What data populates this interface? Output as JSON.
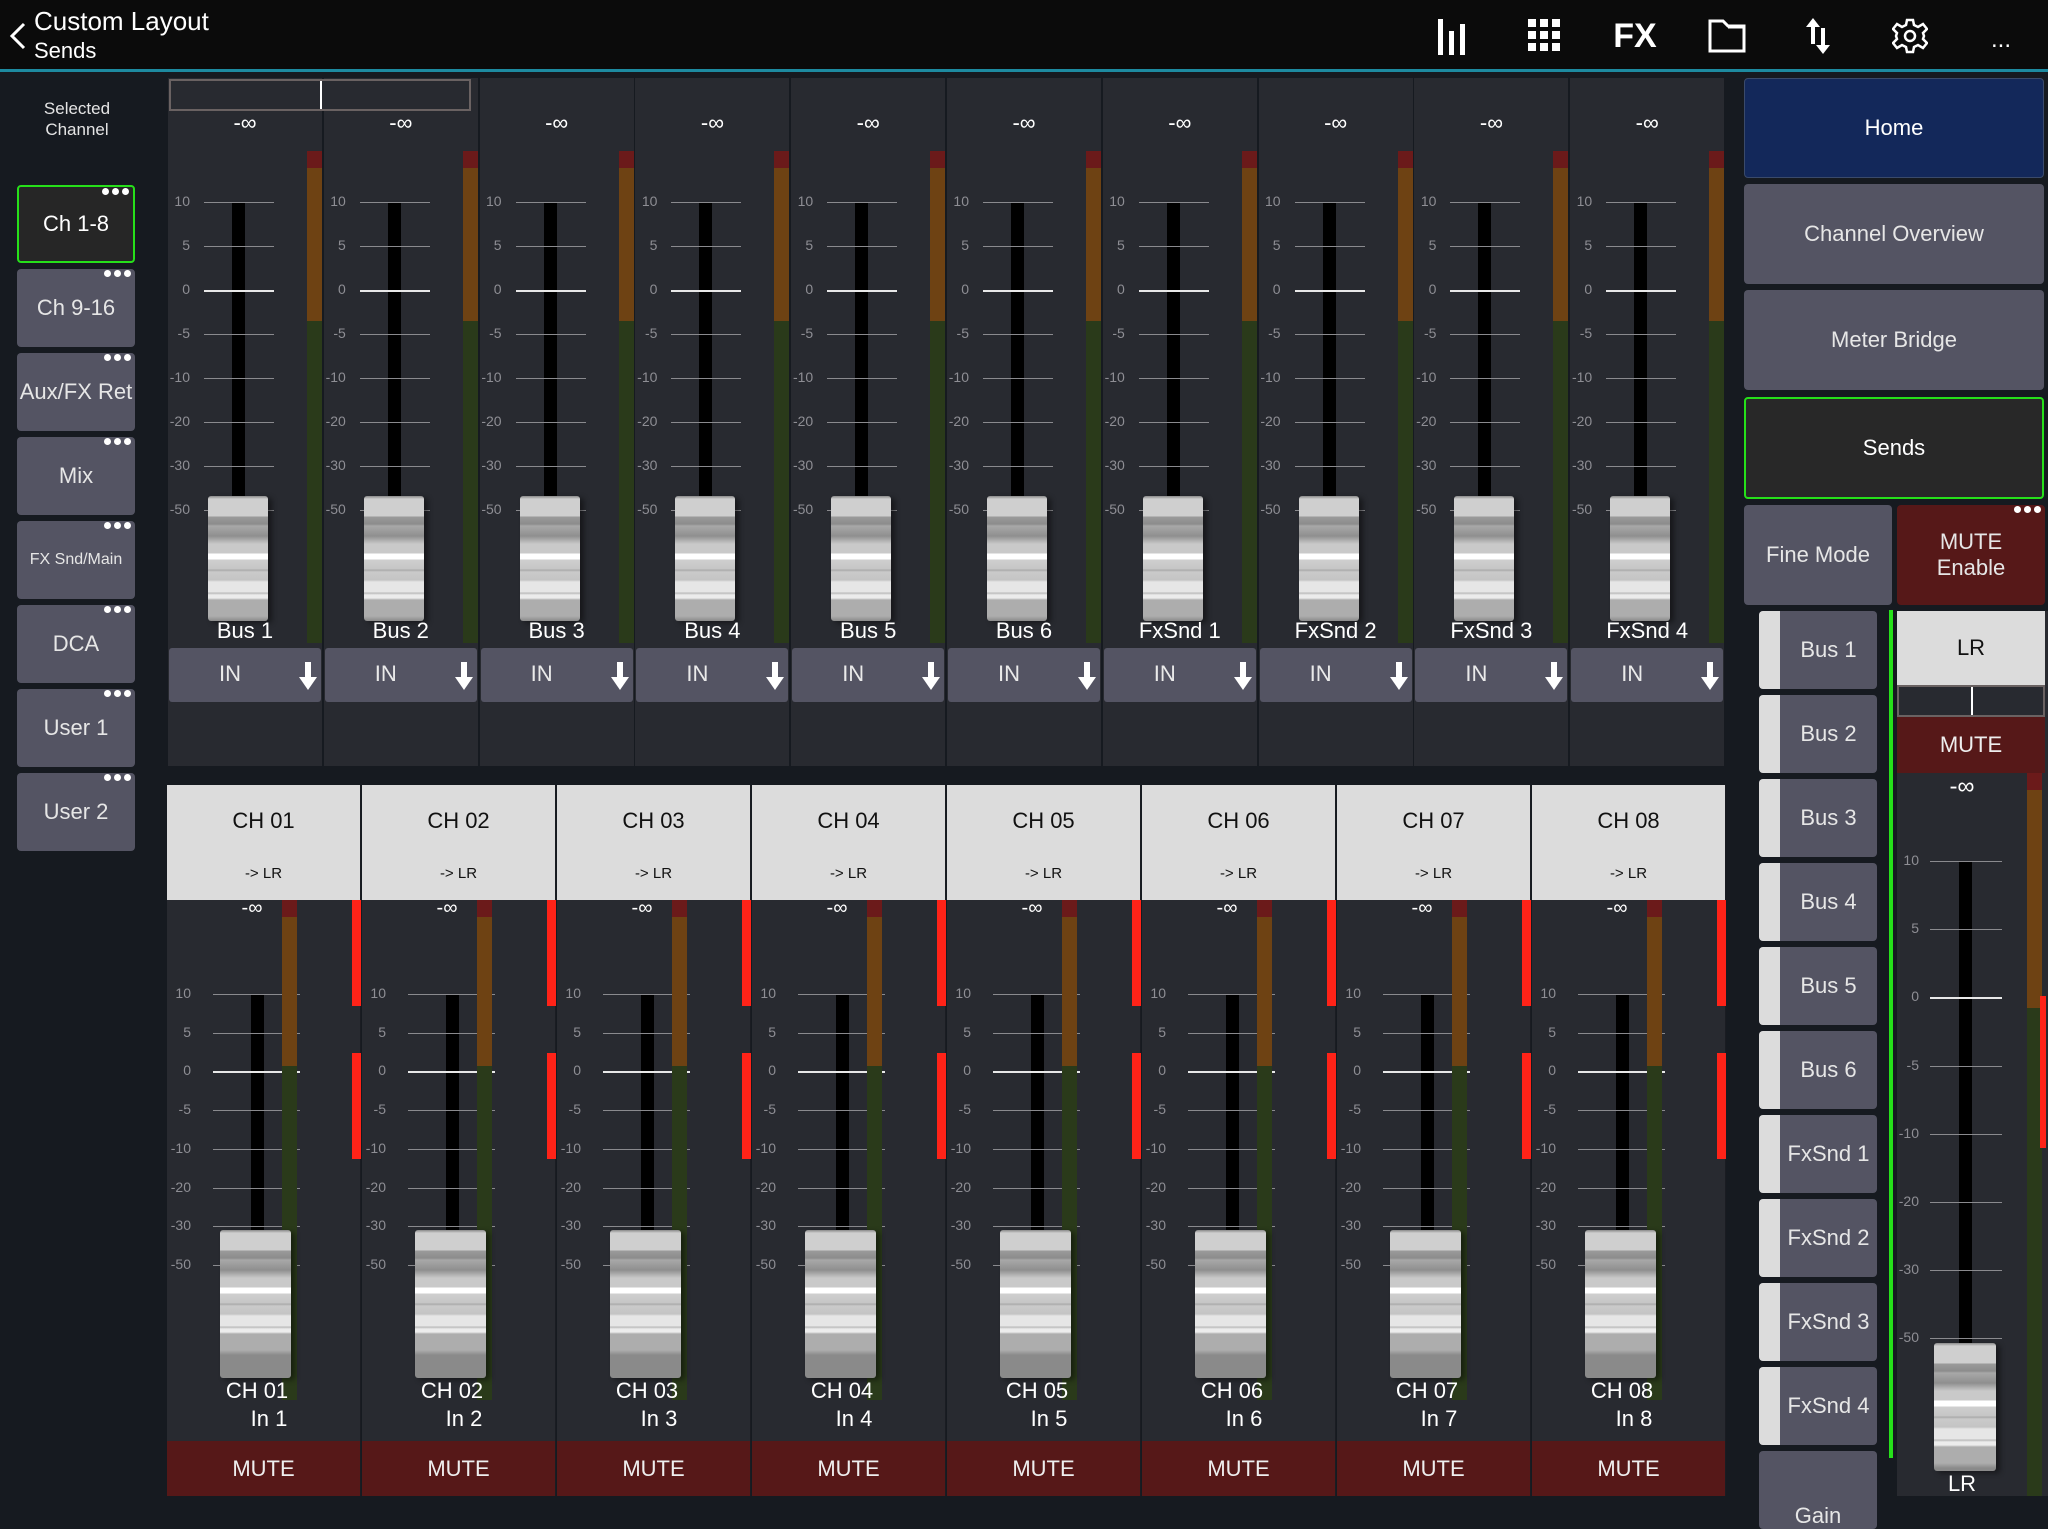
{
  "header": {
    "title": "Custom Layout",
    "subtitle": "Sends",
    "toolbar": [
      {
        "name": "meters-icon"
      },
      {
        "name": "grid-icon"
      },
      {
        "name": "fx-icon",
        "label": "FX"
      },
      {
        "name": "folder-icon"
      },
      {
        "name": "transfer-icon"
      },
      {
        "name": "gear-icon"
      },
      {
        "name": "more-icon",
        "label": "..."
      }
    ]
  },
  "sidebar": {
    "label": "Selected Channel",
    "items": [
      {
        "label": "Ch 1-8",
        "active": true
      },
      {
        "label": "Ch 9-16"
      },
      {
        "label": "Aux/FX Ret"
      },
      {
        "label": "Mix"
      },
      {
        "label": "FX Snd/Main",
        "small": true
      },
      {
        "label": "DCA"
      },
      {
        "label": "User 1"
      },
      {
        "label": "User 2"
      }
    ]
  },
  "scale": [
    "10",
    "5",
    "0",
    "-5",
    "-10",
    "-20",
    "-30",
    "-50"
  ],
  "bus_strips": [
    {
      "name": "Bus 1",
      "value": "-∞",
      "route": "IN"
    },
    {
      "name": "Bus 2",
      "value": "-∞",
      "route": "IN"
    },
    {
      "name": "Bus 3",
      "value": "-∞",
      "route": "IN"
    },
    {
      "name": "Bus 4",
      "value": "-∞",
      "route": "IN"
    },
    {
      "name": "Bus 5",
      "value": "-∞",
      "route": "IN"
    },
    {
      "name": "Bus 6",
      "value": "-∞",
      "route": "IN"
    },
    {
      "name": "FxSnd 1",
      "value": "-∞",
      "route": "IN"
    },
    {
      "name": "FxSnd 2",
      "value": "-∞",
      "route": "IN"
    },
    {
      "name": "FxSnd 3",
      "value": "-∞",
      "route": "IN"
    },
    {
      "name": "FxSnd 4",
      "value": "-∞",
      "route": "IN"
    }
  ],
  "channels": [
    {
      "header": "CH 01",
      "route": "-> LR",
      "value": "-∞",
      "name": "CH 01",
      "source": "In 1",
      "mute": "MUTE"
    },
    {
      "header": "CH 02",
      "route": "-> LR",
      "value": "-∞",
      "name": "CH 02",
      "source": "In 2",
      "mute": "MUTE"
    },
    {
      "header": "CH 03",
      "route": "-> LR",
      "value": "-∞",
      "name": "CH 03",
      "source": "In 3",
      "mute": "MUTE"
    },
    {
      "header": "CH 04",
      "route": "-> LR",
      "value": "-∞",
      "name": "CH 04",
      "source": "In 4",
      "mute": "MUTE"
    },
    {
      "header": "CH 05",
      "route": "-> LR",
      "value": "-∞",
      "name": "CH 05",
      "source": "In 5",
      "mute": "MUTE"
    },
    {
      "header": "CH 06",
      "route": "-> LR",
      "value": "-∞",
      "name": "CH 06",
      "source": "In 6",
      "mute": "MUTE"
    },
    {
      "header": "CH 07",
      "route": "-> LR",
      "value": "-∞",
      "name": "CH 07",
      "source": "In 7",
      "mute": "MUTE"
    },
    {
      "header": "CH 08",
      "route": "-> LR",
      "value": "-∞",
      "name": "CH 08",
      "source": "In 8",
      "mute": "MUTE"
    }
  ],
  "right_panel": {
    "nav": [
      {
        "label": "Home",
        "kind": "home"
      },
      {
        "label": "Channel Overview"
      },
      {
        "label": "Meter Bridge"
      },
      {
        "label": "Sends",
        "kind": "sends"
      }
    ],
    "fine_mode": "Fine Mode",
    "mute_enable": "MUTE\nEnable",
    "bus_list": [
      "Bus 1",
      "Bus 2",
      "Bus 3",
      "Bus 4",
      "Bus 5",
      "Bus 6",
      "FxSnd 1",
      "FxSnd 2",
      "FxSnd 3",
      "FxSnd 4",
      "Gain"
    ],
    "main": {
      "header": "LR",
      "mute": "MUTE",
      "value": "-∞",
      "name": "LR"
    },
    "main_scale": [
      "10",
      "5",
      "0",
      "-5",
      "-10",
      "-20",
      "-30",
      "-50"
    ]
  },
  "colors": {
    "accent_green": "#26e01a",
    "teal_line": "#1d8aa0",
    "mute_red": "#561818",
    "home_blue": "#13285a",
    "meter_green": "#2a3a1a",
    "meter_orange": "#6e4213",
    "meter_red": "#6b1a1a",
    "clip_red": "#ff2318"
  }
}
